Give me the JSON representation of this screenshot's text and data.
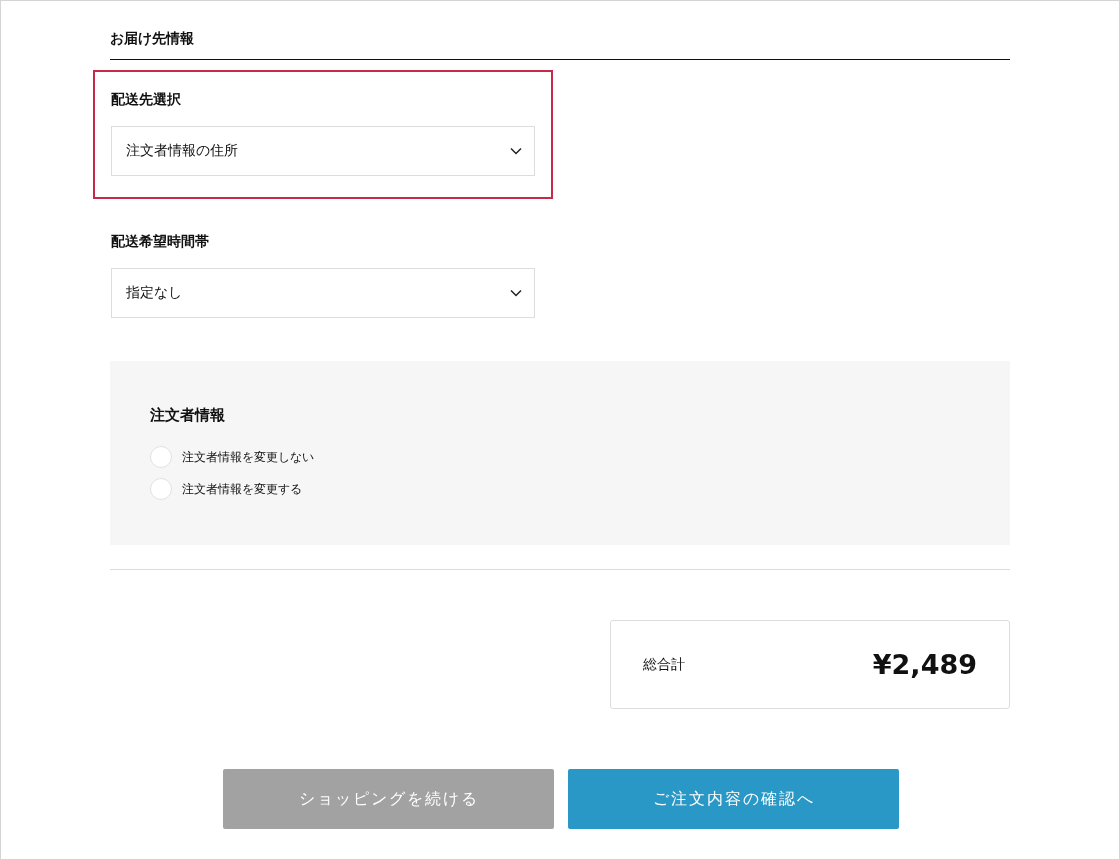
{
  "section_title": "お届け先情報",
  "fields": [
    {
      "label": "配送先選択",
      "value": "注文者情報の住所",
      "highlighted": true
    },
    {
      "label": "配送希望時間帯",
      "value": "指定なし",
      "highlighted": false
    }
  ],
  "orderer_panel": {
    "title": "注文者情報",
    "options": [
      {
        "label": "注文者情報を変更しない",
        "selected": false
      },
      {
        "label": "注文者情報を変更する",
        "selected": false
      }
    ]
  },
  "total": {
    "label": "総合計",
    "amount": "¥2,489"
  },
  "buttons": [
    {
      "label": "ショッピングを続ける",
      "kind": "secondary"
    },
    {
      "label": "ご注文内容の確認へ",
      "kind": "primary"
    }
  ]
}
